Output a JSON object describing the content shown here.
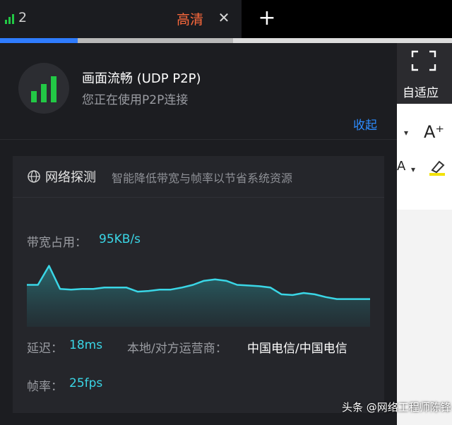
{
  "tab": {
    "title": "2",
    "quality": "高清",
    "close_glyph": "✕",
    "new_tab_glyph": "+",
    "icon": "signal-bars-icon"
  },
  "status": {
    "title": "画面流畅 (UDP P2P)",
    "subtitle": "您正在使用P2P连接",
    "collapse": "收起",
    "icon": "signal-bars-icon",
    "signal_color": "#22c845"
  },
  "probe": {
    "title": "网络探测",
    "description": "智能降低带宽与帧率以节省系统资源",
    "icon": "globe-icon",
    "bandwidth_label": "带宽占用：",
    "bandwidth_value": "95KB/s",
    "latency_label": "延迟：",
    "latency_value": "18ms",
    "isp_label": "本地/对方运营商：",
    "isp_value": "中国电信/中国电信",
    "fps_label": "帧率：",
    "fps_value": "25fps",
    "accent_color": "#3ad6e6"
  },
  "chart_data": {
    "type": "area",
    "values": [
      62,
      62,
      90,
      56,
      55,
      56,
      56,
      58,
      58,
      58,
      52,
      53,
      55,
      55,
      58,
      62,
      68,
      70,
      68,
      62,
      61,
      60,
      58,
      48,
      47,
      50,
      48,
      44,
      41,
      41,
      41,
      41
    ],
    "ylim": [
      0,
      100
    ]
  },
  "app": {
    "fit_label": "自适应",
    "fit_icon": "fullscreen-icon",
    "font_tool": "A⁺",
    "caret": "▾",
    "a_tool": "A",
    "highlight_icon": "highlighter-icon"
  },
  "watermark": "头条 @网络工程师陈锋"
}
